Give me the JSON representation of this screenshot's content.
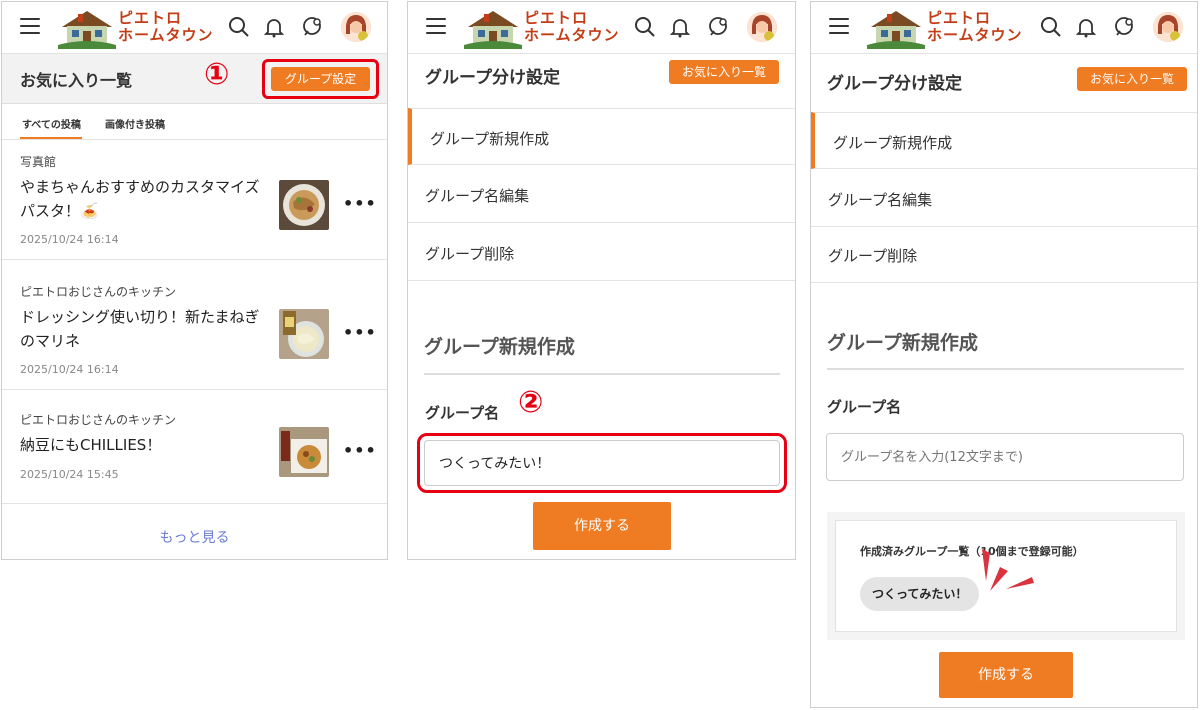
{
  "header": {
    "logo_line1": "ピエトロ",
    "logo_line2": "ホームタウン"
  },
  "panel1": {
    "title": "お気に入り一覧",
    "group_settings_button": "グループ設定",
    "step_marker": "①",
    "tabs": [
      {
        "label": "すべての投稿"
      },
      {
        "label": "画像付き投稿"
      }
    ],
    "posts": [
      {
        "category": "写真館",
        "title": "やまちゃんおすすめのカスタマイズパスタ！🍝",
        "date": "2025/10/24 16:14"
      },
      {
        "category": "ピエトロおじさんのキッチン",
        "title": "ドレッシング使い切り！新たまねぎのマリネ",
        "date": "2025/10/24 16:14"
      },
      {
        "category": "ピエトロおじさんのキッチン",
        "title": "納豆にもCHILLIES！",
        "date": "2025/10/24 15:45"
      }
    ],
    "more_posts_dots": "•••",
    "more_link": "もっと見る"
  },
  "panel2": {
    "title": "グループ分け設定",
    "favorites_button": "お気に入り一覧",
    "menu": [
      "グループ新規作成",
      "グループ名編集",
      "グループ削除"
    ],
    "section_title": "グループ新規作成",
    "field_label": "グループ名",
    "step_marker": "②",
    "input_value": "つくってみたい！",
    "create_button": "作成する"
  },
  "panel3": {
    "title": "グループ分け設定",
    "favorites_button": "お気に入り一覧",
    "menu": [
      "グループ新規作成",
      "グループ名編集",
      "グループ削除"
    ],
    "section_title": "グループ新規作成",
    "field_label": "グループ名",
    "input_placeholder": "グループ名を入力(12文字まで)",
    "groups_label": "作成済みグループ一覧（10個まで登録可能）",
    "group_chip": "つくってみたい！",
    "create_button": "作成する"
  },
  "colors": {
    "accent": "#ef7b22",
    "highlight_red": "#e60012",
    "link": "#6b7bd6"
  }
}
